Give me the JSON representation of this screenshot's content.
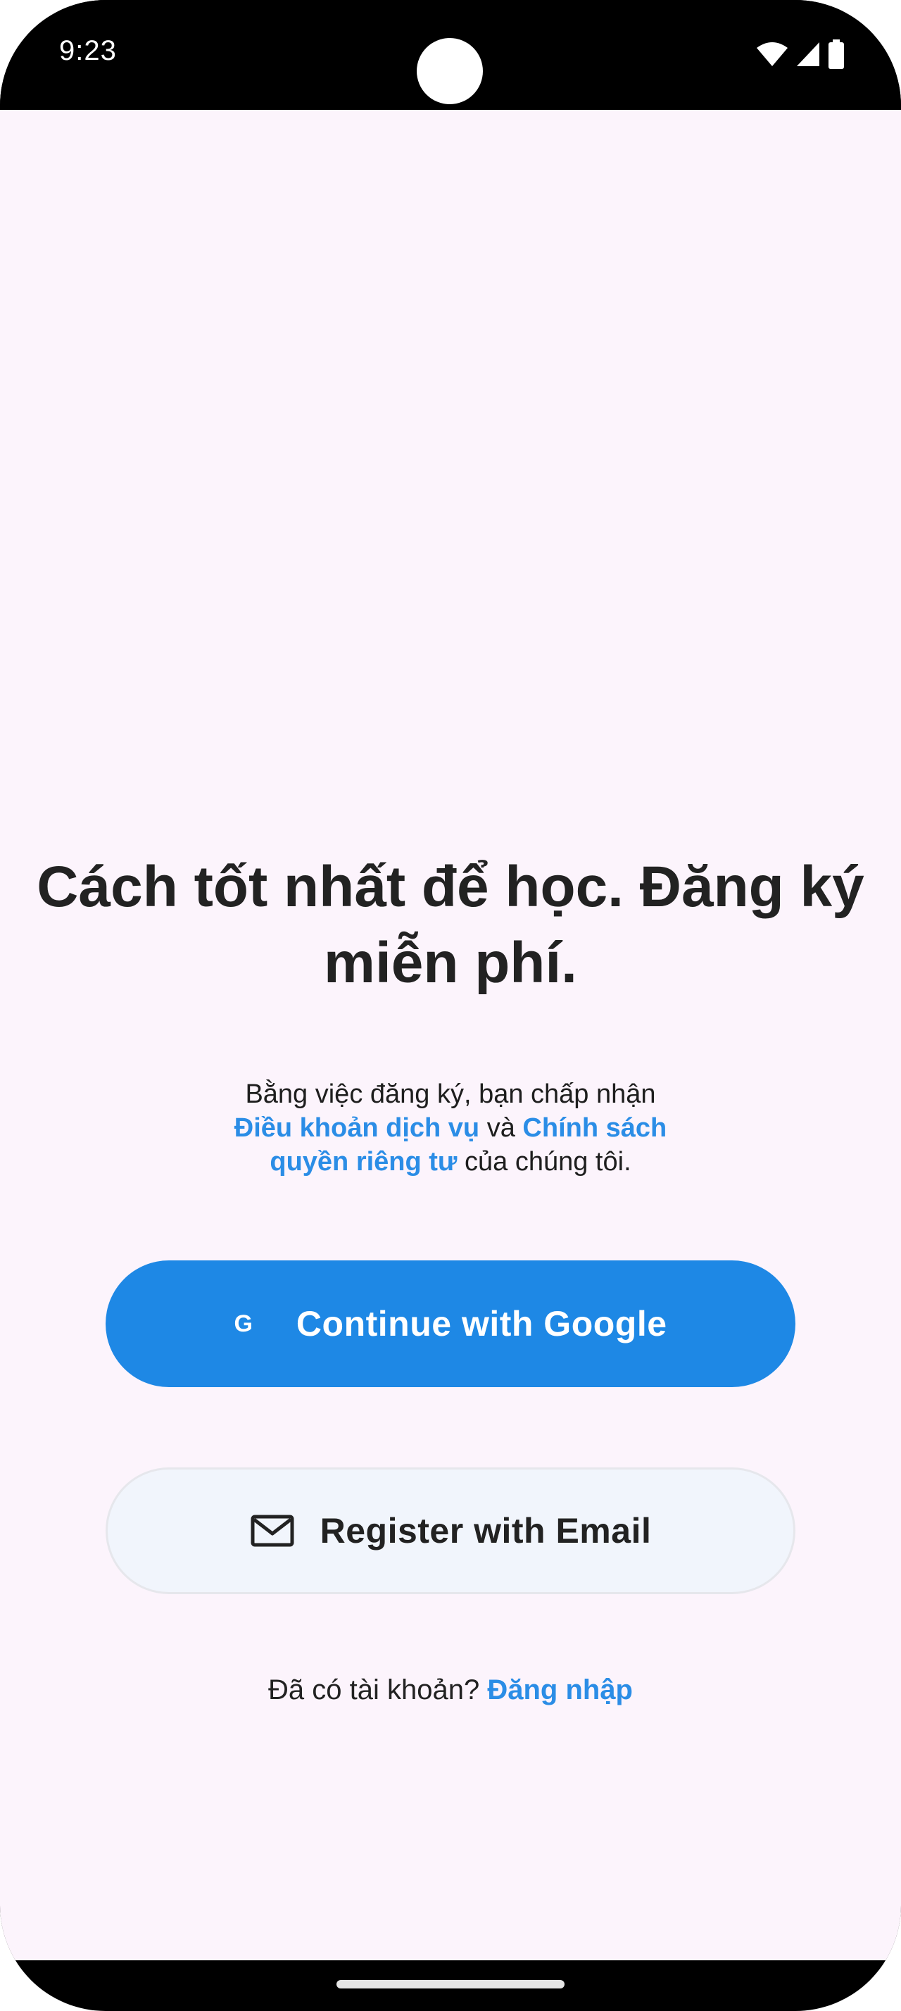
{
  "status_bar": {
    "time": "9:23",
    "icons": [
      "wifi-icon",
      "cellular-signal-icon",
      "battery-icon"
    ]
  },
  "headline": "Cách tốt nhất để học. Đăng ký miễn phí.",
  "terms": {
    "prefix": "Bằng việc đăng ký, bạn chấp nhận",
    "terms_link": "Điều khoản dịch vụ",
    "connector": "và",
    "privacy_link": "Chính sách quyền riêng tư",
    "suffix": "của chúng tôi."
  },
  "buttons": {
    "google": {
      "icon_glyph": "G",
      "label": "Continue with Google"
    },
    "email": {
      "label": "Register with Email"
    }
  },
  "signin": {
    "prompt": "Đã có tài khoản?",
    "link": "Đăng nhập"
  },
  "colors": {
    "accent": "#1e88e5",
    "link": "#2b8de6",
    "background": "#fcf4fc"
  }
}
